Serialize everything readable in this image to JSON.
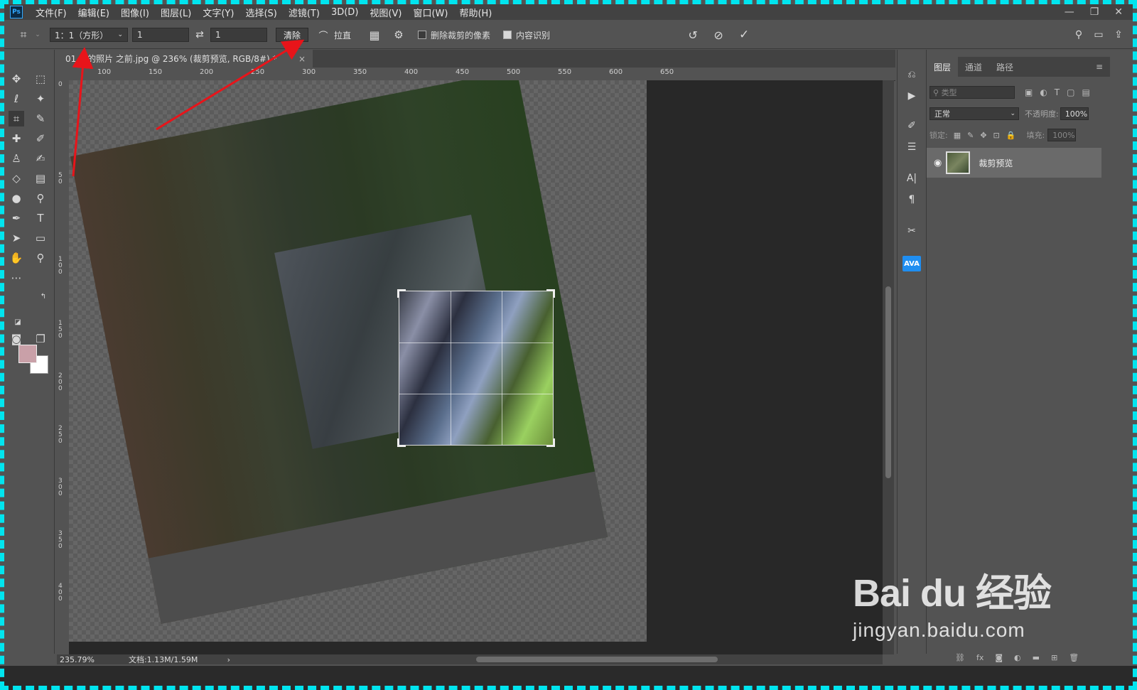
{
  "menubar": {
    "app_icon": "Ps",
    "items": [
      "文件(F)",
      "编辑(E)",
      "图像(I)",
      "图层(L)",
      "文字(Y)",
      "选择(S)",
      "滤镜(T)",
      "3D(D)",
      "视图(V)",
      "窗口(W)",
      "帮助(H)"
    ]
  },
  "options": {
    "ratio_select": "1：1（方形）",
    "width_value": "1",
    "height_value": "1",
    "clear_label": "清除",
    "straighten_label": "拉直",
    "delete_cropped_label": "删除裁剪的像素",
    "content_aware_label": "内容识别",
    "delete_cropped_checked": false,
    "content_aware_checked": true
  },
  "document": {
    "tab_title": "01 歪的照片 之前.jpg @ 236% (裁剪预览, RGB/8#) *",
    "close": "×",
    "ruler_h_ticks": [
      "100",
      "150",
      "200",
      "250",
      "300",
      "350",
      "400",
      "450",
      "500",
      "550",
      "600",
      "650"
    ],
    "ruler_v_ticks": [
      "0",
      "50",
      "100",
      "150",
      "200",
      "250",
      "300",
      "350",
      "400"
    ],
    "status_zoom": "235.79%",
    "status_doc": "文档:1.13M/1.59M"
  },
  "layers_panel": {
    "tabs": [
      "图层",
      "通道",
      "路径"
    ],
    "filter_placeholder": "类型",
    "blend_mode": "正常",
    "opacity_label": "不透明度:",
    "opacity_value": "100%",
    "lock_label": "锁定:",
    "fill_label": "填充:",
    "fill_value": "100%",
    "layer_name": "裁剪预览"
  },
  "iconcol": {
    "ava": "AVA"
  },
  "watermark": {
    "brand": "Bai du 经验",
    "url": "jingyan.baidu.com"
  },
  "colors": {
    "foreground": "#c9a0a8",
    "background": "#ffffff",
    "frame": "#00e5ef",
    "arrow": "#e8141a"
  }
}
